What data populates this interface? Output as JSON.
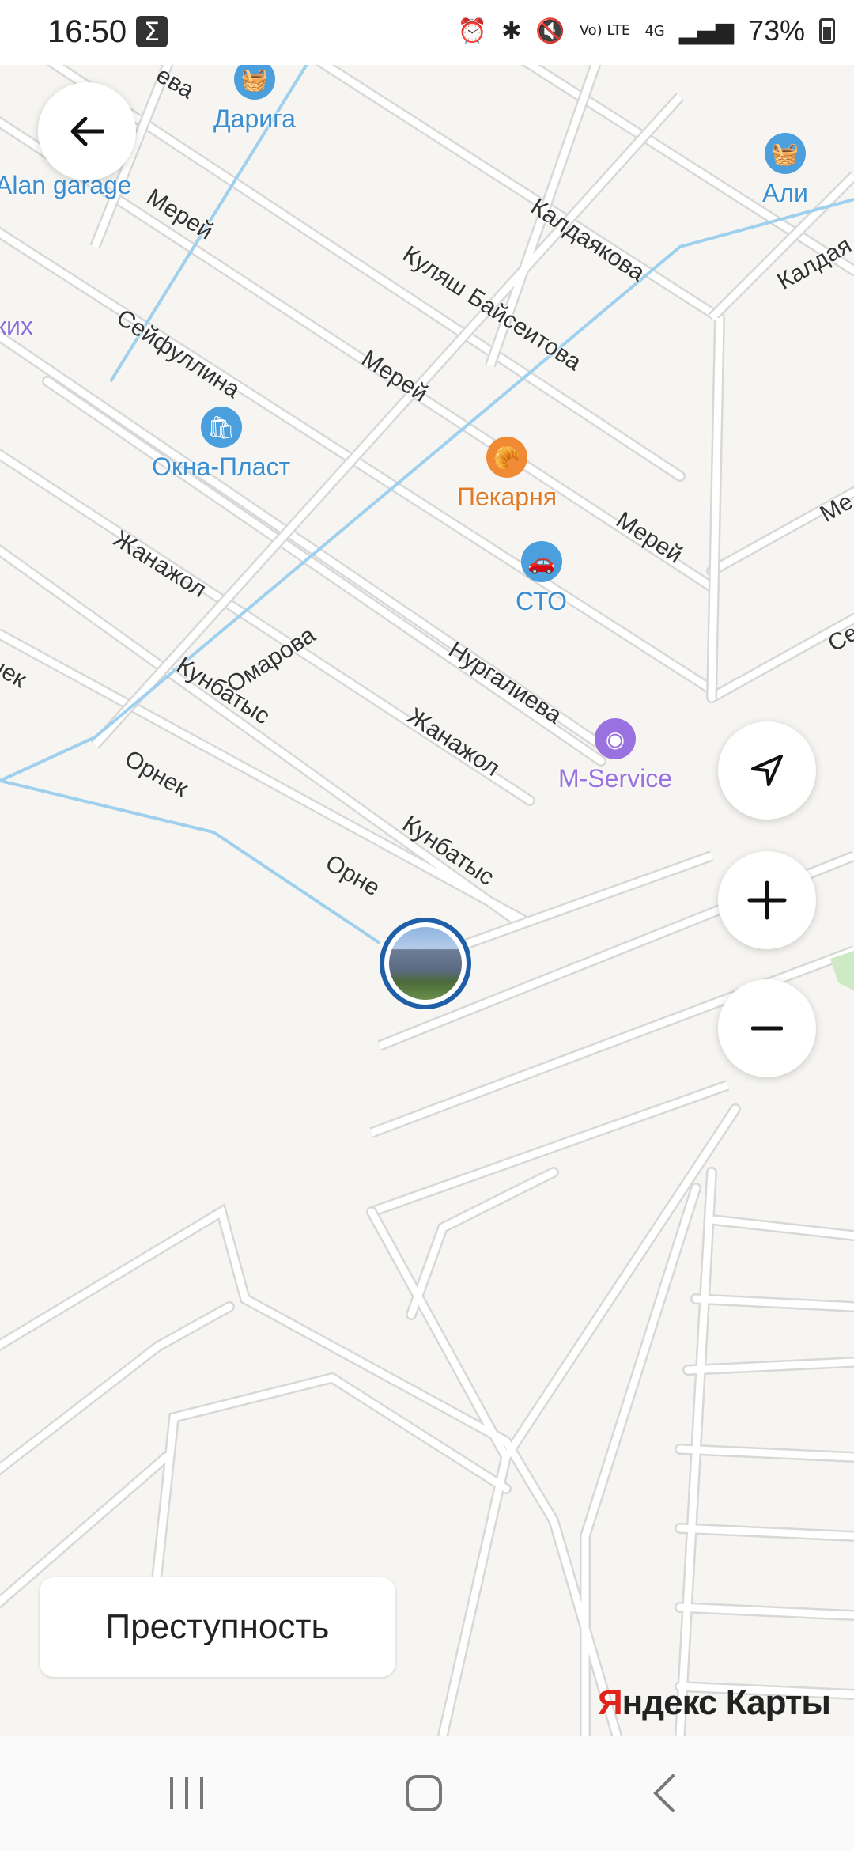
{
  "status_bar": {
    "time": "16:50",
    "battery": "73%",
    "net_label_volte": "Vo) LTE",
    "net_label_4g": "4G"
  },
  "map": {
    "streets": [
      {
        "name": "Мерей"
      },
      {
        "name": "Куляш Байсеитова"
      },
      {
        "name": "Калдаякова"
      },
      {
        "name": "Калдая"
      },
      {
        "name": "Сейфуллина"
      },
      {
        "name": "Мерей"
      },
      {
        "name": "Мерей"
      },
      {
        "name": "Ме"
      },
      {
        "name": "Жанажол"
      },
      {
        "name": "Омарова"
      },
      {
        "name": "Нургалиева"
      },
      {
        "name": "Се"
      },
      {
        "name": "Кунбатыс"
      },
      {
        "name": "Жанажол"
      },
      {
        "name": "Орнек"
      },
      {
        "name": "Кунбатыс"
      },
      {
        "name": "Орне"
      },
      {
        "name": "нек"
      },
      {
        "name": "ева"
      }
    ],
    "pois": [
      {
        "name": "Дарига",
        "icon": "basket-icon",
        "color": "#4a9fdc"
      },
      {
        "name": "Alan garage",
        "icon": "basket-icon",
        "color": "#4a9fdc"
      },
      {
        "name": "Али",
        "icon": "basket-icon",
        "color": "#4a9fdc"
      },
      {
        "name": "ких",
        "icon": "none",
        "color": "#8b6fd8"
      },
      {
        "name": "Окна-Пласт",
        "icon": "shopping-bag-icon",
        "color": "#4a9fdc"
      },
      {
        "name": "Пекарня",
        "icon": "bakery-icon",
        "color": "#f08a35"
      },
      {
        "name": "СТО",
        "icon": "car-icon",
        "color": "#4a9fdc"
      },
      {
        "name": "M-Service",
        "icon": "circle-dot-icon",
        "color": "#9a72e0"
      }
    ]
  },
  "controls": {
    "crime_button": "Преступность",
    "brand_y": "Я",
    "brand_rest": "ндекс Карты"
  }
}
